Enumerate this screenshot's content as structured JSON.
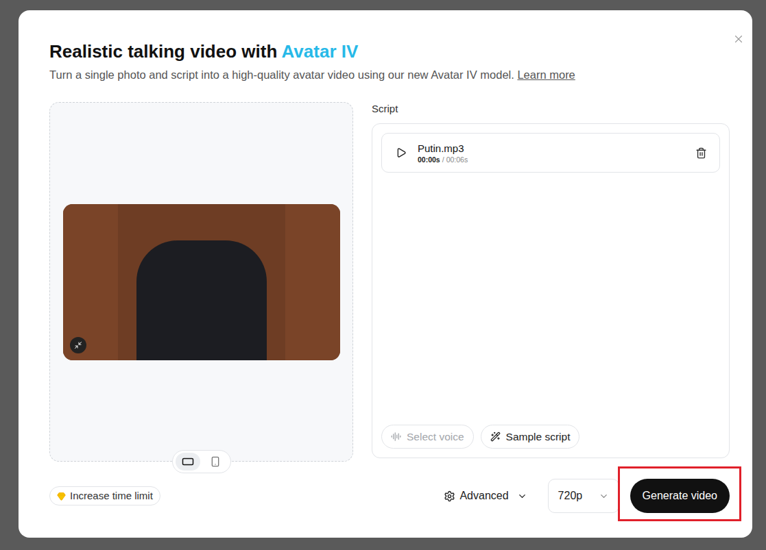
{
  "dialog": {
    "title": "Realistic talking video with ",
    "title_accent": "Avatar IV",
    "subtitle": "Turn a single photo and script into a high-quality avatar video using our new Avatar IV model.",
    "learn_more": "Learn more"
  },
  "orientation": [
    {
      "kind": "landscape",
      "selected": true
    },
    {
      "kind": "portrait",
      "selected": false
    }
  ],
  "script": {
    "label": "Script",
    "audio": {
      "file": "Putin.mp3",
      "elapsed": "00:00s",
      "separator": "/",
      "duration": "00:06s",
      "playing": false
    },
    "actions": [
      {
        "label": "Select voice",
        "kind": "voice",
        "disabled": true
      },
      {
        "label": "Sample script",
        "kind": "sample",
        "disabled": false
      }
    ]
  },
  "footer": {
    "upgrade": "Increase time limit",
    "advanced": "Advanced",
    "resolution": "720p",
    "generate": {
      "label": "Generate video",
      "highlighted": true
    }
  }
}
